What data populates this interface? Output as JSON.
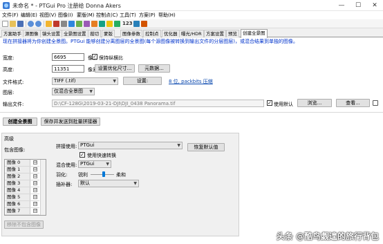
{
  "window": {
    "title": "未命名 * - PTGui Pro 注册给 Donna Akers",
    "min_icon": "minimize-icon",
    "max_icon": "maximize-icon",
    "close_icon": "close-icon",
    "min_glyph": "—",
    "max_glyph": "☐",
    "close_glyph": "✕"
  },
  "menu": [
    "文件(F)",
    "编辑(E)",
    "视图(V)",
    "图像(I)",
    "蒙版(M)",
    "控制点(C)",
    "工具(T)",
    "方案(P)",
    "帮助(H)"
  ],
  "toolbar": {
    "number_label": "123"
  },
  "tabs": [
    "方案助手",
    "源图像",
    "镜头设置",
    "全景图设置",
    "裁切",
    "蒙版",
    "图像参数",
    "控制点",
    "优化器",
    "曝光/HDR",
    "方案设置",
    "预览",
    "创建全景图"
  ],
  "active_tab": "创建全景图",
  "hint": "现在拼接器将为你创建全景图。PTGui 能够创建分离图层的全景图(每个源图像被转换到输出文件的分层图层)，或混合结果到单独的图像。",
  "form": {
    "width_label": "宽度:",
    "width_value": "6695",
    "pixels_unit": "像素",
    "keep_ratio_label": "保持纵横比",
    "keep_ratio_checked": "✓",
    "height_label": "高度:",
    "height_value": "11351",
    "set_optimal_size_button": "设置优化尺寸...",
    "metadata_button": "元数据...",
    "file_format_label": "文件格式:",
    "file_format_value": "TIFF (.tif)",
    "settings_button": "设置:",
    "compression_link": "8 位, packbits 压缩",
    "layers_label": "图层:",
    "layers_value": "仅混合全景图",
    "output_file_label": "输出文件:",
    "output_file_value": "D:\\CF-128G\\2019-03-21-DJI\\DJI_0438 Panorama.tif",
    "use_default_label": "使用默认",
    "use_default_checked": "✓",
    "browse_button": "浏览...",
    "view_button": "查看...",
    "create_panorama_button": "创建全景图",
    "save_and_send_button": "保存并发送到批量拼接器"
  },
  "advanced": {
    "section_label": "高级",
    "include_images_label": "包含图像:",
    "images": [
      {
        "name": "图像 0",
        "check": "☑"
      },
      {
        "name": "图像 1",
        "check": "☑"
      },
      {
        "name": "图像 2",
        "check": "☑"
      },
      {
        "name": "图像 3",
        "check": "☑"
      },
      {
        "name": "图像 4",
        "check": "☑"
      },
      {
        "name": "图像 5",
        "check": "☑"
      },
      {
        "name": "图像 6",
        "check": "☑"
      },
      {
        "name": "图像 7",
        "check": "☑"
      }
    ],
    "exclude_button": "移除不包含图像",
    "stitch_with_label": "拼接使用:",
    "stitch_with_value": "PTGui",
    "fast_transform_label": "使用快速转换",
    "fast_transform_checked": "✓",
    "blend_with_label": "混合使用:",
    "blend_with_value": "PTGui",
    "feather_label": "羽化:",
    "feather_sharp": "锐利",
    "feather_soft": "柔和",
    "feather_level": 0.55,
    "interpolator_label": "插补器:",
    "interpolator_value": "默认",
    "restore_defaults_button": "恢复默认值"
  },
  "watermark": "头条 @酷鸟觑遑的旅行背包"
}
